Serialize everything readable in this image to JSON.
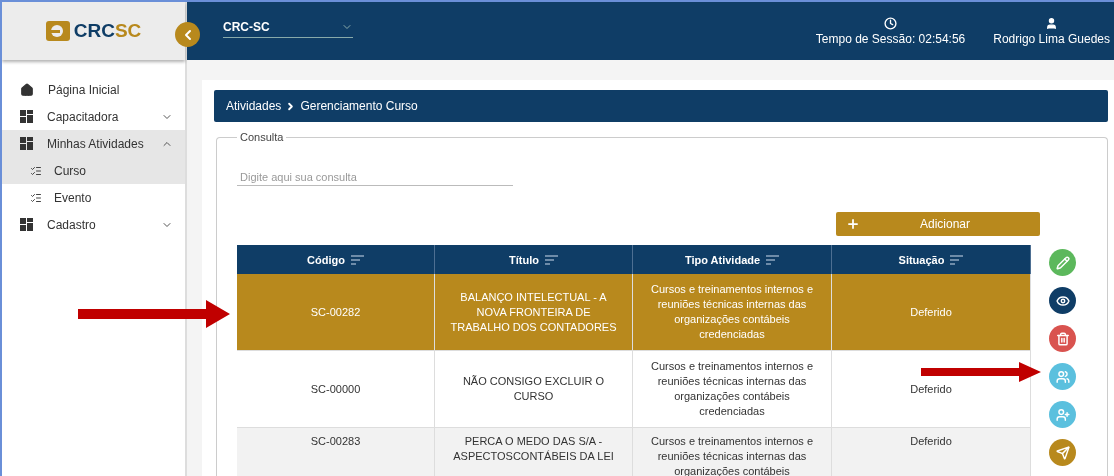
{
  "logo": {
    "part_1": "CRC",
    "part_2": "SC"
  },
  "header": {
    "unit_select": "CRC-SC",
    "session": "Tempo de Sessão: 02:54:56",
    "user": "Rodrigo Lima Guedes"
  },
  "sidebar": {
    "items": [
      {
        "label": "Página Inicial",
        "selected": false
      },
      {
        "label": "Capacitadora",
        "expanded": false
      },
      {
        "label": "Minhas Atividades",
        "expanded": true,
        "children": [
          {
            "label": "Curso",
            "selected": true
          },
          {
            "label": "Evento",
            "selected": false
          }
        ]
      },
      {
        "label": "Cadastro",
        "expanded": false
      }
    ]
  },
  "breadcrumb": [
    "Atividades",
    "Gerenciamento Curso"
  ],
  "query": {
    "legend": "Consulta",
    "placeholder": "Digite aqui sua consulta"
  },
  "add_button": "Adicionar",
  "table": {
    "columns": [
      "Código",
      "Título",
      "Tipo Atividade",
      "Situação"
    ],
    "rows": [
      {
        "selected": true,
        "cells": [
          "SC-00282",
          "BALANÇO INTELECTUAL - A NOVA FRONTEIRA DE TRABALHO DOS CONTADORES",
          "Cursos e treinamentos internos e reuniões técnicas internas das organizações contábeis credenciadas",
          "Deferido"
        ]
      },
      {
        "selected": false,
        "cells": [
          "SC-00000",
          "NÃO CONSIGO EXCLUIR O CURSO",
          "Cursos e treinamentos internos e reuniões técnicas internas das organizações contábeis credenciadas",
          "Deferido"
        ]
      },
      {
        "selected": false,
        "cells": [
          "SC-00283",
          "PERCA O MEDO DAS S/A - ASPECTOSCONTÁBEIS DA LEI",
          "Cursos e treinamentos internos e reuniões técnicas internas das organizações contábeis",
          "Deferido"
        ]
      }
    ]
  },
  "actions": [
    {
      "kind": "edit",
      "color": "#5cb85c"
    },
    {
      "kind": "view",
      "color": "#0f3d66"
    },
    {
      "kind": "delete",
      "color": "#d9534f"
    },
    {
      "kind": "participants",
      "color": "#5bc0de"
    },
    {
      "kind": "add-person",
      "color": "#5bc0de"
    },
    {
      "kind": "send",
      "color": "#b8891d"
    }
  ]
}
